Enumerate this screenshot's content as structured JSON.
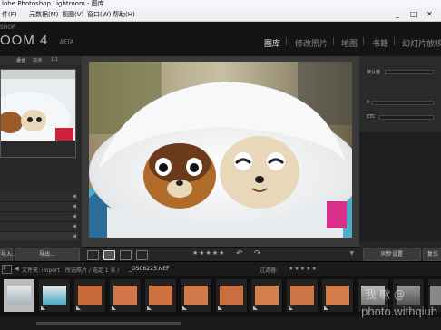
{
  "window": {
    "title": "lobe Photoshop Lightroom - 图库"
  },
  "menubar": {
    "items": [
      "件(F)",
      "元数据(M)",
      "视图(V)",
      "窗口(W)",
      "帮助(H)"
    ],
    "window_controls": [
      "_",
      "□",
      "✕"
    ]
  },
  "identity": {
    "app_small": "SHOP",
    "app_name": "OOM 4",
    "beta": "BETA",
    "modules": [
      "图库",
      "修改照片",
      "地图",
      "书籍",
      "幻灯片放映"
    ]
  },
  "left_panel": {
    "navigator_options": [
      "适合",
      "填满",
      "1:1"
    ],
    "import_label": "导入...",
    "export_label": "导出..."
  },
  "toolbar": {
    "rating": "★★★★★"
  },
  "right_panel": {
    "label_1": "默认值",
    "label_2": "0",
    "label_3": "ETC",
    "sync_label": "同步设置",
    "reset_label": "复位"
  },
  "filmstrip_header": {
    "pages": [
      "1",
      "2"
    ],
    "path_prefix": "文件夹: import",
    "path_meta": "所选照片 / 选定 1 张 /",
    "filename": "_DSC6225.NEF",
    "filter_label": "过滤器:",
    "filter_stars": "★★★★★"
  },
  "filmstrip": {
    "selected_index": 0,
    "count": 13
  },
  "watermark": {
    "cn": "我 嗽 @",
    "url": "photo.withqiuh"
  },
  "colors": {
    "active_module": "#e6e6e6",
    "panel_bg": "#282828",
    "center_bg": "#3a3a3a"
  }
}
